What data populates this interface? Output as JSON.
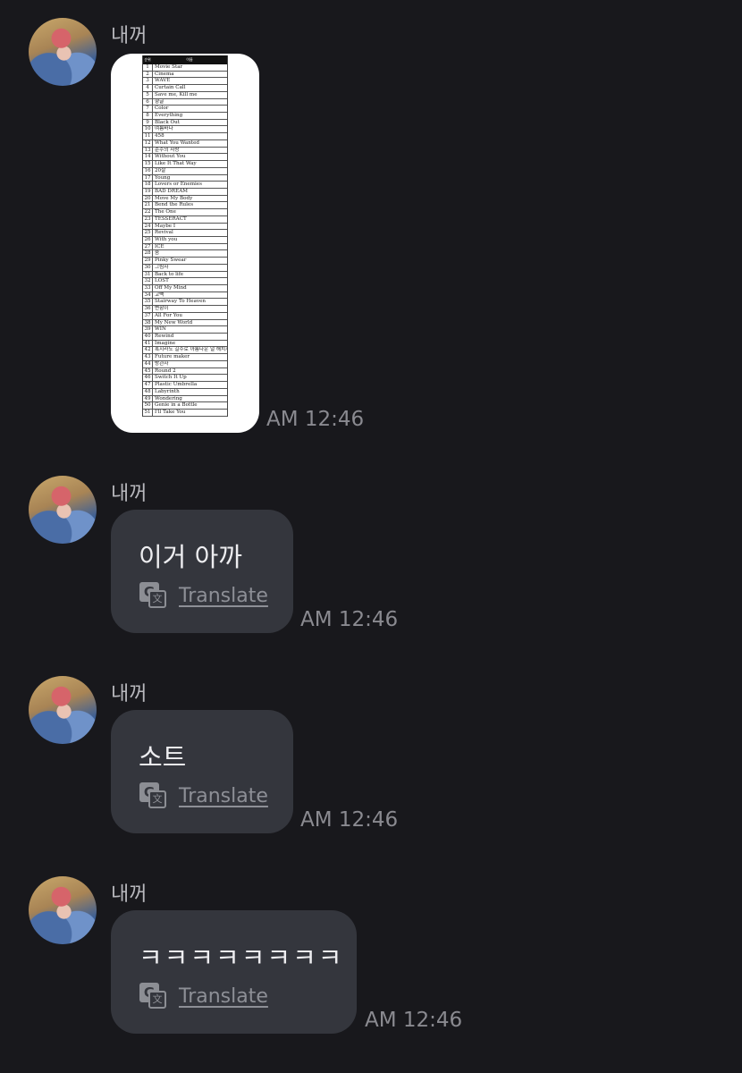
{
  "sender_name": "내꺼",
  "translate_label": "Translate",
  "messages": [
    {
      "type": "image",
      "time": "AM 12:46"
    },
    {
      "type": "text",
      "text": "이거 아까",
      "time": "AM 12:46"
    },
    {
      "type": "text",
      "text": "소트",
      "time": "AM 12:46"
    },
    {
      "type": "text",
      "text": "ㅋㅋㅋㅋㅋㅋㅋㅋ",
      "time": "AM 12:46"
    }
  ],
  "ranking_sheet": {
    "headers": [
      "순위",
      "이름"
    ],
    "rows": [
      [
        "1",
        "Movie Star"
      ],
      [
        "2",
        "Cinema"
      ],
      [
        "3",
        "WAVE"
      ],
      [
        "4",
        "Curtain Call"
      ],
      [
        "5",
        "Save me, Kill me"
      ],
      [
        "6",
        "향글"
      ],
      [
        "7",
        "Color"
      ],
      [
        "8",
        "Everything"
      ],
      [
        "9",
        "Black Out"
      ],
      [
        "10",
        "여름바다"
      ],
      [
        "11",
        "458"
      ],
      [
        "12",
        "What You Wanted"
      ],
      [
        "13",
        "순수의 사랑"
      ],
      [
        "14",
        "Without You"
      ],
      [
        "15",
        "Like It That Way"
      ],
      [
        "16",
        "20살"
      ],
      [
        "17",
        "Young"
      ],
      [
        "18",
        "Lovers or Enemies"
      ],
      [
        "19",
        "BAD DREAM"
      ],
      [
        "20",
        "Move My Body"
      ],
      [
        "21",
        "Bend the Rules"
      ],
      [
        "22",
        "The One"
      ],
      [
        "23",
        "TESSERACT"
      ],
      [
        "24",
        "Maybe I"
      ],
      [
        "25",
        "Revival"
      ],
      [
        "26",
        "With you"
      ],
      [
        "27",
        "ICE"
      ],
      [
        "28",
        "숨"
      ],
      [
        "29",
        "Pinky Swear"
      ],
      [
        "30",
        "그림자"
      ],
      [
        "31",
        "Back to life"
      ],
      [
        "32",
        "LOST"
      ],
      [
        "33",
        "Off My Mind"
      ],
      [
        "34",
        "고백"
      ],
      [
        "35",
        "Stairway To Heaven"
      ],
      [
        "36",
        "변함이"
      ],
      [
        "37",
        "All For You"
      ],
      [
        "38",
        "My New World"
      ],
      [
        "39",
        "WIN"
      ],
      [
        "40",
        "Rewind"
      ],
      [
        "41",
        "Imagine"
      ],
      [
        "42",
        "혹시라도 길수로 아름다운 널 해치지 않게"
      ],
      [
        "43",
        "Future maker"
      ],
      [
        "44",
        "방관자"
      ],
      [
        "45",
        "Round 2"
      ],
      [
        "46",
        "Switch It Up"
      ],
      [
        "47",
        "Plastic Umbrella"
      ],
      [
        "48",
        "Labyrinth"
      ],
      [
        "49",
        "Wondering"
      ],
      [
        "50",
        "Genie in a Bottle"
      ],
      [
        "51",
        "I'll Take You"
      ]
    ]
  }
}
